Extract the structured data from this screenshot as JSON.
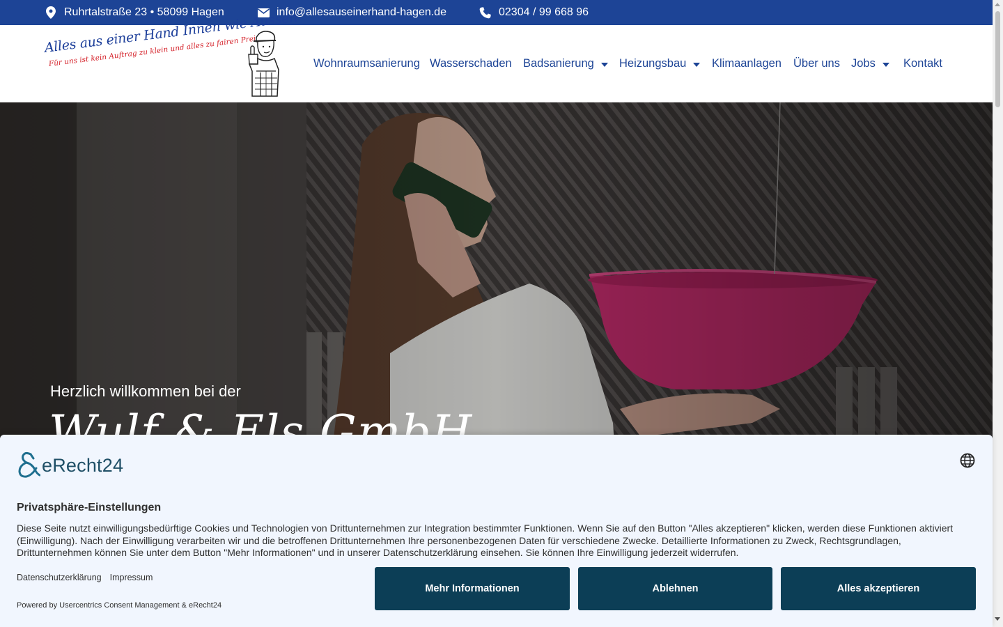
{
  "topbar": {
    "address": "Ruhrtalstraße 23 • 58099 Hagen",
    "email": "info@allesauseinerhand-hagen.de",
    "phone": "02304 / 99 668 96",
    "background": "#1d4496"
  },
  "logo": {
    "line1": "Alles aus einer Hand Innen wie Aussen",
    "line2": "Für uns ist kein Auftrag zu klein und alles zu fairen Preisen"
  },
  "nav": {
    "items": [
      {
        "label": "Wohnraumsanierung",
        "dropdown": false
      },
      {
        "label": "Wasserschaden",
        "dropdown": false
      },
      {
        "label": "Badsanierung",
        "dropdown": true
      },
      {
        "label": "Heizungsbau",
        "dropdown": true
      },
      {
        "label": "Klimaanlagen",
        "dropdown": false
      },
      {
        "label": "Über uns",
        "dropdown": false
      },
      {
        "label": "Jobs",
        "dropdown": true
      },
      {
        "label": "Kontakt",
        "dropdown": false
      }
    ],
    "color": "#1d4496"
  },
  "hero": {
    "welcome": "Herzlich willkommen bei der",
    "brand": "Wulf & Els GmbH"
  },
  "consent": {
    "brand": "eRecht24",
    "title": "Privatsphäre-Einstellungen",
    "text": "Diese Seite nutzt einwilligungsbedürftige Cookies und Technologien von Drittunternehmen zur Integration bestimmter Funktionen. Wenn Sie auf den Button \"Alles akzeptieren\" klicken, werden diese Funktionen aktiviert (Einwilligung). Nach der Einwilligung verarbeiten wir und die betroffenen Drittunternehmen Ihre personenbezogenen Daten für verschiedene Zwecke. Detaillierte Informationen zu Zweck, Rechtsgrundlagen, Drittunternehmen können Sie unter dem Button \"Mehr Informationen\" und in unserer Datenschutzerklärung einsehen. Sie können Ihre Einwilligung jederzeit widerrufen.",
    "links": [
      "Datenschutzerklärung",
      "Impressum"
    ],
    "powered": "Powered by Usercentrics Consent Management & eRecht24",
    "buttons": {
      "more": "Mehr Informationen",
      "deny": "Ablehnen",
      "accept": "Alles akzeptieren"
    },
    "button_color": "#0c3e56",
    "background": "#f1f6fe"
  }
}
